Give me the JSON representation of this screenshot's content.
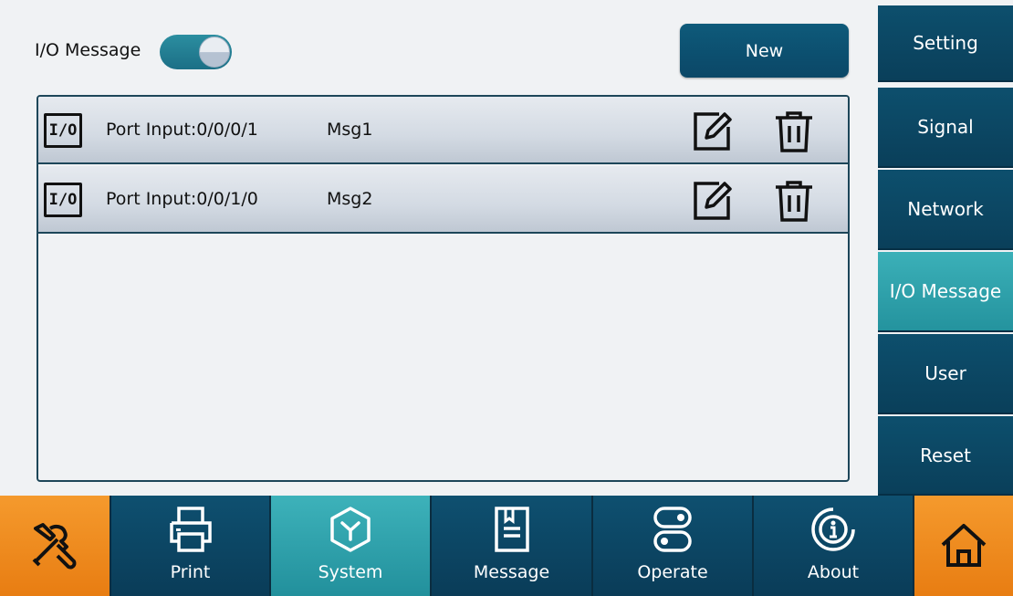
{
  "header": {
    "title": "I/O Message",
    "toggle_on": true,
    "new_label": "New"
  },
  "messages": [
    {
      "badge": "I/O",
      "port": "Port Input:0/0/0/1",
      "name": "Msg1"
    },
    {
      "badge": "I/O",
      "port": "Port Input:0/0/1/0",
      "name": "Msg2"
    }
  ],
  "sidebar": {
    "items": [
      {
        "label": "Setting"
      },
      {
        "label": "Signal"
      },
      {
        "label": "Network"
      },
      {
        "label": "I/O Message",
        "active": true
      },
      {
        "label": "User"
      },
      {
        "label": "Reset"
      }
    ]
  },
  "bottombar": {
    "items": [
      {
        "label": "",
        "icon": "tools-icon"
      },
      {
        "label": "Print",
        "icon": "printer-icon"
      },
      {
        "label": "System",
        "icon": "system-icon",
        "active": true
      },
      {
        "label": "Message",
        "icon": "message-icon"
      },
      {
        "label": "Operate",
        "icon": "operate-icon"
      },
      {
        "label": "About",
        "icon": "info-icon"
      },
      {
        "label": "",
        "icon": "home-icon"
      }
    ]
  },
  "colors": {
    "primary": "#0b4767",
    "active": "#2aa0aa",
    "orange": "#f08a1f",
    "border": "#1d4659"
  }
}
